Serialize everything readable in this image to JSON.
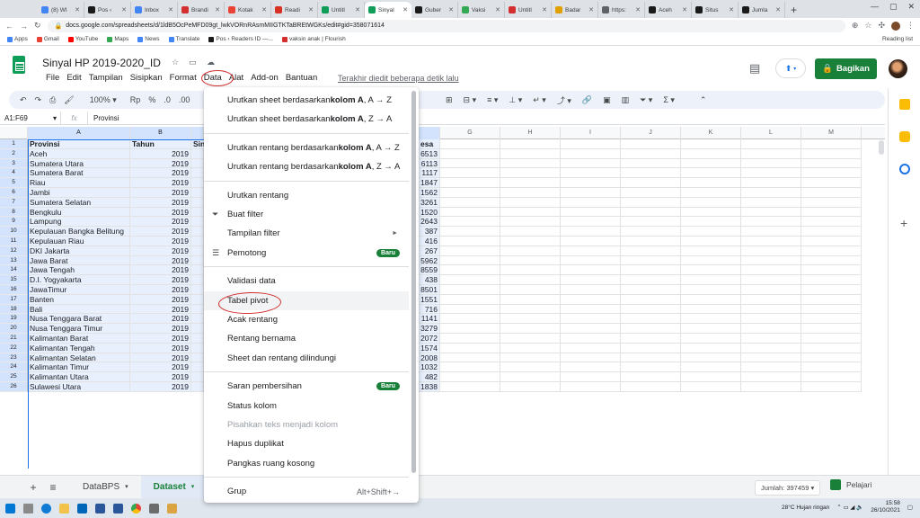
{
  "browser": {
    "tabs": [
      {
        "label": "(8) WI",
        "color": "#4285f4"
      },
      {
        "label": "Pos ‹",
        "color": "#1a1a1a"
      },
      {
        "label": "Inbox",
        "color": "#4285f4"
      },
      {
        "label": "Brandi",
        "color": "#d32f2f"
      },
      {
        "label": "Kotak",
        "color": "#ea4335"
      },
      {
        "label": "Readi",
        "color": "#d93025"
      },
      {
        "label": "Untitl",
        "color": "#0f9d58"
      },
      {
        "label": "Sinyal",
        "color": "#0f9d58",
        "active": true
      },
      {
        "label": "Guber",
        "color": "#1a1a1a"
      },
      {
        "label": "Vaksi",
        "color": "#34a853"
      },
      {
        "label": "Untitl",
        "color": "#d32f2f"
      },
      {
        "label": "Badar",
        "color": "#e0a000"
      },
      {
        "label": "https:",
        "color": "#5f6368"
      },
      {
        "label": "Aceh",
        "color": "#1a1a1a"
      },
      {
        "label": "Situs",
        "color": "#1a1a1a"
      },
      {
        "label": "Jumla",
        "color": "#1a1a1a"
      }
    ],
    "url": "docs.google.com/spreadsheets/d/1ldB5OcPeMFD09gt_lwkVORnRAsmMIIGTKTaBREtWGKs/edit#gid=358071614",
    "bookmarks": [
      "Apps",
      "Gmail",
      "YouTube",
      "Maps",
      "News",
      "Translate",
      "Pos ‹ Readers ID —...",
      "vaksin anak | Flourish"
    ],
    "reading_list": "Reading list"
  },
  "sheets": {
    "doc_title": "Sinyal HP 2019-2020_ID",
    "menu": [
      "File",
      "Edit",
      "Tampilan",
      "Sisipkan",
      "Format",
      "Data",
      "Alat",
      "Add-on",
      "Bantuan"
    ],
    "last_edit": "Terakhir diedit beberapa detik lalu",
    "share_label": "Bagikan",
    "toolbar": {
      "zoom": "100%",
      "currency": "Rp",
      "percent": "%",
      "dec1": ".0",
      "dec2": ".00"
    },
    "name_box": "A1:F69",
    "formula_value": "Provinsi",
    "columns": [
      "A",
      "B",
      "",
      "",
      "",
      "",
      "G",
      "H",
      "I",
      "J",
      "K",
      "L",
      "M"
    ],
    "header_row": [
      "Provinsi",
      "Tahun",
      "Sin",
      "esa"
    ],
    "rows": [
      {
        "n": "2",
        "prov": "Aceh",
        "year": "2019",
        "val": "6513"
      },
      {
        "n": "3",
        "prov": "Sumatera Utara",
        "year": "2019",
        "val": "6113"
      },
      {
        "n": "4",
        "prov": "Sumatera Barat",
        "year": "2019",
        "val": "1117"
      },
      {
        "n": "5",
        "prov": "Riau",
        "year": "2019",
        "val": "1847"
      },
      {
        "n": "6",
        "prov": "Jambi",
        "year": "2019",
        "val": "1562"
      },
      {
        "n": "7",
        "prov": "Sumatera Selatan",
        "year": "2019",
        "val": "3261"
      },
      {
        "n": "8",
        "prov": "Bengkulu",
        "year": "2019",
        "val": "1520"
      },
      {
        "n": "9",
        "prov": "Lampung",
        "year": "2019",
        "val": "2643"
      },
      {
        "n": "10",
        "prov": "Kepulauan Bangka Belitung",
        "year": "2019",
        "val": "387"
      },
      {
        "n": "11",
        "prov": "Kepulauan Riau",
        "year": "2019",
        "val": "416"
      },
      {
        "n": "12",
        "prov": "DKI Jakarta",
        "year": "2019",
        "val": "267"
      },
      {
        "n": "13",
        "prov": "Jawa Barat",
        "year": "2019",
        "val": "5962"
      },
      {
        "n": "14",
        "prov": "Jawa Tengah",
        "year": "2019",
        "val": "8559"
      },
      {
        "n": "15",
        "prov": "D.I. Yogyakarta",
        "year": "2019",
        "val": "438"
      },
      {
        "n": "16",
        "prov": "JawaTimur",
        "year": "2019",
        "val": "8501"
      },
      {
        "n": "17",
        "prov": "Banten",
        "year": "2019",
        "val": "1551"
      },
      {
        "n": "18",
        "prov": "Bali",
        "year": "2019",
        "val": "716"
      },
      {
        "n": "19",
        "prov": "Nusa Tenggara Barat",
        "year": "2019",
        "val": "1141"
      },
      {
        "n": "20",
        "prov": "Nusa Tenggara Timur",
        "year": "2019",
        "val": "3279"
      },
      {
        "n": "21",
        "prov": "Kalimantan Barat",
        "year": "2019",
        "val": "2072"
      },
      {
        "n": "22",
        "prov": "Kalimantan Tengah",
        "year": "2019",
        "val": "1574"
      },
      {
        "n": "23",
        "prov": "Kalimantan Selatan",
        "year": "2019",
        "val": "2008"
      },
      {
        "n": "24",
        "prov": "Kalimantan Timur",
        "year": "2019",
        "val": "1032"
      },
      {
        "n": "25",
        "prov": "Kalimantan Utara",
        "year": "2019",
        "val": "482"
      },
      {
        "n": "26",
        "prov": "Sulawesi Utara",
        "year": "2019",
        "val": "1838"
      }
    ],
    "sheet_tabs": [
      "DataBPS",
      "Dataset"
    ],
    "sum_label": "Jumlah: 397459",
    "learn_label": "Pelajari"
  },
  "data_menu": {
    "items": [
      {
        "key": "sort_sheet_az",
        "pre": "Urutkan sheet berdasarkan ",
        "bold": "kolom A",
        "post": ", A → Z"
      },
      {
        "key": "sort_sheet_za",
        "pre": "Urutkan sheet berdasarkan ",
        "bold": "kolom A",
        "post": ", Z → A"
      },
      {
        "key": "sort_range_az",
        "pre": "Urutkan rentang berdasarkan ",
        "bold": "kolom A",
        "post": ", A → Z"
      },
      {
        "key": "sort_range_za",
        "pre": "Urutkan rentang berdasarkan ",
        "bold": "kolom A",
        "post": ", Z → A"
      }
    ],
    "sort_range": "Urutkan rentang",
    "create_filter": "Buat filter",
    "filter_views": "Tampilan filter",
    "slicer": "Pemotong",
    "new_badge": "Baru",
    "data_validation": "Validasi data",
    "pivot_table": "Tabel pivot",
    "randomize": "Acak rentang",
    "named_ranges": "Rentang bernama",
    "protected": "Sheet dan rentang dilindungi",
    "cleanup": "Saran pembersihan",
    "column_stats": "Status kolom",
    "split_text": "Pisahkan teks menjadi kolom",
    "remove_dup": "Hapus duplikat",
    "trim": "Pangkas ruang kosong",
    "group": "Grup",
    "group_shortcut": "Alt+Shift+→"
  },
  "taskbar": {
    "weather": "28°C  Hujan ringan",
    "time": "15:58",
    "date": "26/10/2021"
  }
}
